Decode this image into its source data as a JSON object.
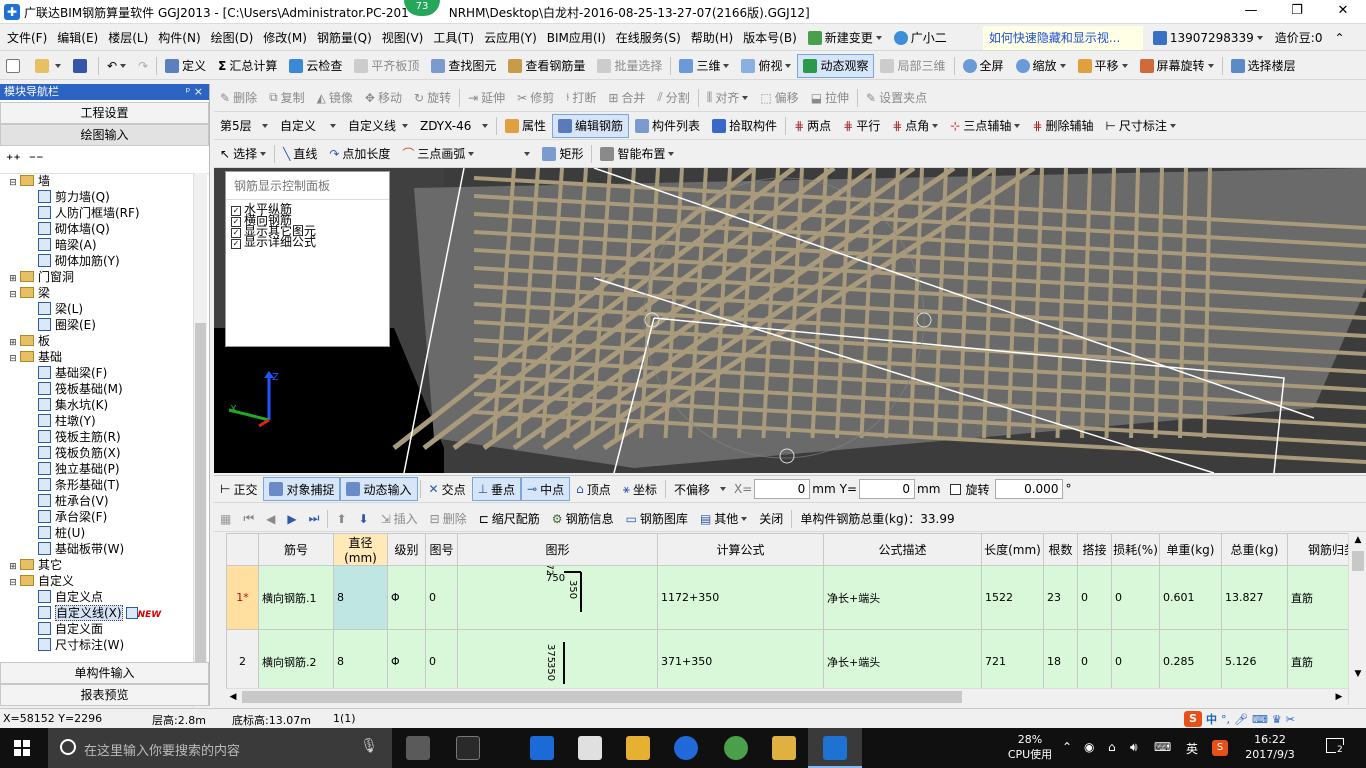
{
  "window": {
    "title": "广联达BIM钢筋算量软件 GGJ2013 - [C:\\Users\\Administrator.PC-201",
    "title_tail": "NRHM\\Desktop\\白龙村-2016-08-25-13-27-07(2166版).GGJ12]",
    "badge": "73",
    "btn_min": "—",
    "btn_max": "❐",
    "btn_close": "✕"
  },
  "menu": {
    "items": [
      "文件(F)",
      "编辑(E)",
      "楼层(L)",
      "构件(N)",
      "绘图(D)",
      "修改(M)",
      "钢筋量(Q)",
      "视图(V)",
      "工具(T)",
      "云应用(Y)",
      "BIM应用(I)",
      "在线服务(S)",
      "帮助(H)",
      "版本号(B)"
    ],
    "new_change": "新建变更",
    "assistant": "广小二",
    "help_link": "如何快速隐藏和显示视...",
    "phone": "13907298339",
    "cost_bean": "造价豆:0"
  },
  "toolbar1": {
    "define": "定义",
    "sum_calc": "汇总计算",
    "cloud_check": "云检查",
    "flush_board": "平齐板顶",
    "find_element": "查找图元",
    "view_rebar_qty": "查看钢筋量",
    "batch_select": "批量选择",
    "three_d": "三维",
    "top_view": "俯视",
    "dynamic_observe": "动态观察",
    "local_3d": "局部三维",
    "full_screen": "全屏",
    "zoom": "缩放",
    "pan": "平移",
    "screen_rotate": "屏幕旋转",
    "select_floor": "选择楼层"
  },
  "toolbar2": {
    "delete": "删除",
    "copy": "复制",
    "mirror": "镜像",
    "move": "移动",
    "rotate": "旋转",
    "extend": "延伸",
    "trim": "修剪",
    "break": "打断",
    "merge": "合并",
    "split": "分割",
    "align": "对齐",
    "offset": "偏移",
    "stretch": "拉伸",
    "set_clamp": "设置夹点"
  },
  "toolbar3": {
    "floor": "第5层",
    "custom": "自定义",
    "custom_line": "自定义线",
    "code": "ZDYX-46",
    "property": "属性",
    "edit_rebar": "编辑钢筋",
    "component_list": "构件列表",
    "pick_component": "拾取构件",
    "two_points": "两点",
    "parallel": "平行",
    "point_angle": "点角",
    "three_point_axis": "三点辅轴",
    "delete_axis": "删除辅轴",
    "dim_label": "尺寸标注"
  },
  "toolbar4": {
    "select": "选择",
    "line": "直线",
    "point_add_length": "点加长度",
    "three_point_arc": "三点画弧",
    "rect": "矩形",
    "smart_layout": "智能布置"
  },
  "nav": {
    "header": "模块导航栏",
    "pin": "ᵖ",
    "close": "×",
    "project_settings": "工程设置",
    "drawing_input": "绘图输入",
    "single_component_input": "单构件输入",
    "report_preview": "报表预览",
    "tree": [
      {
        "level": 0,
        "toggle": "⊟",
        "label": "墙",
        "folder": true
      },
      {
        "level": 1,
        "label": "剪力墙(Q)"
      },
      {
        "level": 1,
        "label": "人防门框墙(RF)"
      },
      {
        "level": 1,
        "label": "砌体墙(Q)"
      },
      {
        "level": 1,
        "label": "暗梁(A)"
      },
      {
        "level": 1,
        "label": "砌体加筋(Y)"
      },
      {
        "level": 0,
        "toggle": "⊞",
        "label": "门窗洞",
        "folder": true
      },
      {
        "level": 0,
        "toggle": "⊟",
        "label": "梁",
        "folder": true
      },
      {
        "level": 1,
        "label": "梁(L)"
      },
      {
        "level": 1,
        "label": "圈梁(E)"
      },
      {
        "level": 0,
        "toggle": "⊞",
        "label": "板",
        "folder": true
      },
      {
        "level": 0,
        "toggle": "⊟",
        "label": "基础",
        "folder": true
      },
      {
        "level": 1,
        "label": "基础梁(F)"
      },
      {
        "level": 1,
        "label": "筏板基础(M)"
      },
      {
        "level": 1,
        "label": "集水坑(K)"
      },
      {
        "level": 1,
        "label": "柱墩(Y)"
      },
      {
        "level": 1,
        "label": "筏板主筋(R)"
      },
      {
        "level": 1,
        "label": "筏板负筋(X)"
      },
      {
        "level": 1,
        "label": "独立基础(P)"
      },
      {
        "level": 1,
        "label": "条形基础(T)"
      },
      {
        "level": 1,
        "label": "桩承台(V)"
      },
      {
        "level": 1,
        "label": "承台梁(F)"
      },
      {
        "level": 1,
        "label": "桩(U)"
      },
      {
        "level": 1,
        "label": "基础板带(W)"
      },
      {
        "level": 0,
        "toggle": "⊞",
        "label": "其它",
        "folder": true
      },
      {
        "level": 0,
        "toggle": "⊟",
        "label": "自定义",
        "folder": true
      },
      {
        "level": 1,
        "label": "自定义点"
      },
      {
        "level": 1,
        "label": "自定义线(X)",
        "selected": true,
        "new": "NEW"
      },
      {
        "level": 1,
        "label": "自定义面"
      },
      {
        "level": 1,
        "label": "尺寸标注(W)"
      }
    ]
  },
  "rebar_panel": {
    "title": "钢筋显示控制面板",
    "items": [
      "水平纵筋",
      "横向钢筋",
      "显示其它图元",
      "显示详细公式"
    ]
  },
  "snap": {
    "ortho": "正交",
    "object_snap": "对象捕捉",
    "dynamic_input": "动态输入",
    "intersection": "交点",
    "perpendicular": "垂点",
    "midpoint": "中点",
    "vertex": "顶点",
    "coordinate": "坐标",
    "no_offset": "不偏移",
    "x_label": "X=",
    "x_value": "0",
    "y_label": "Y=",
    "y_value": "0",
    "unit": "mm",
    "rotate": "旋转",
    "angle": "0.000",
    "degree": "°"
  },
  "table_toolbar": {
    "insert": "插入",
    "delete": "删除",
    "ruler_rebar": "缩尺配筋",
    "rebar_info": "钢筋信息",
    "rebar_library": "钢筋图库",
    "other": "其他",
    "close": "关闭",
    "total_weight": "单构件钢筋总重(kg)：33.99"
  },
  "table": {
    "headers": [
      "筋号",
      "直径(mm)",
      "级别",
      "图号",
      "图形",
      "计算公式",
      "公式描述",
      "长度(mm)",
      "根数",
      "搭接",
      "损耗(%)",
      "单重(kg)",
      "总重(kg)",
      "钢筋归类"
    ],
    "rows": [
      {
        "num": "1*",
        "name": "横向钢筋.1",
        "dia": "8",
        "grade": "Φ",
        "fig": "0",
        "shape_a": "750",
        "shape_b": "350",
        "shape_c": "72",
        "formula": "1172+350",
        "desc": "净长+端头",
        "len": "1522",
        "count": "23",
        "lap": "0",
        "loss": "0",
        "unit_w": "0.601",
        "total_w": "13.827",
        "cat": "直筋"
      },
      {
        "num": "2",
        "name": "横向钢筋.2",
        "dia": "8",
        "grade": "Φ",
        "fig": "0",
        "shape_a": "375",
        "shape_b": "350",
        "shape_c": "",
        "formula": "371+350",
        "desc": "净长+端头",
        "len": "721",
        "count": "18",
        "lap": "0",
        "loss": "0",
        "unit_w": "0.285",
        "total_w": "5.126",
        "cat": "直筋"
      }
    ]
  },
  "status": {
    "coords": "X=58152 Y=2296",
    "floor_height": "层高:2.8m",
    "bottom_height": "底标高:13.07m",
    "page": "1(1)"
  },
  "taskbar": {
    "search_placeholder": "在这里输入你要搜索的内容",
    "cpu_percent": "28%",
    "cpu_label": "CPU使用",
    "ime": "英",
    "time": "16:22",
    "date": "2017/9/3",
    "notif_count": "2",
    "ime_cn": "中"
  },
  "colors": {
    "accent": "#2c64c4",
    "row_bg": "#d9f7d9",
    "view_bg": "#404040",
    "rebar": "#a89a7a"
  }
}
